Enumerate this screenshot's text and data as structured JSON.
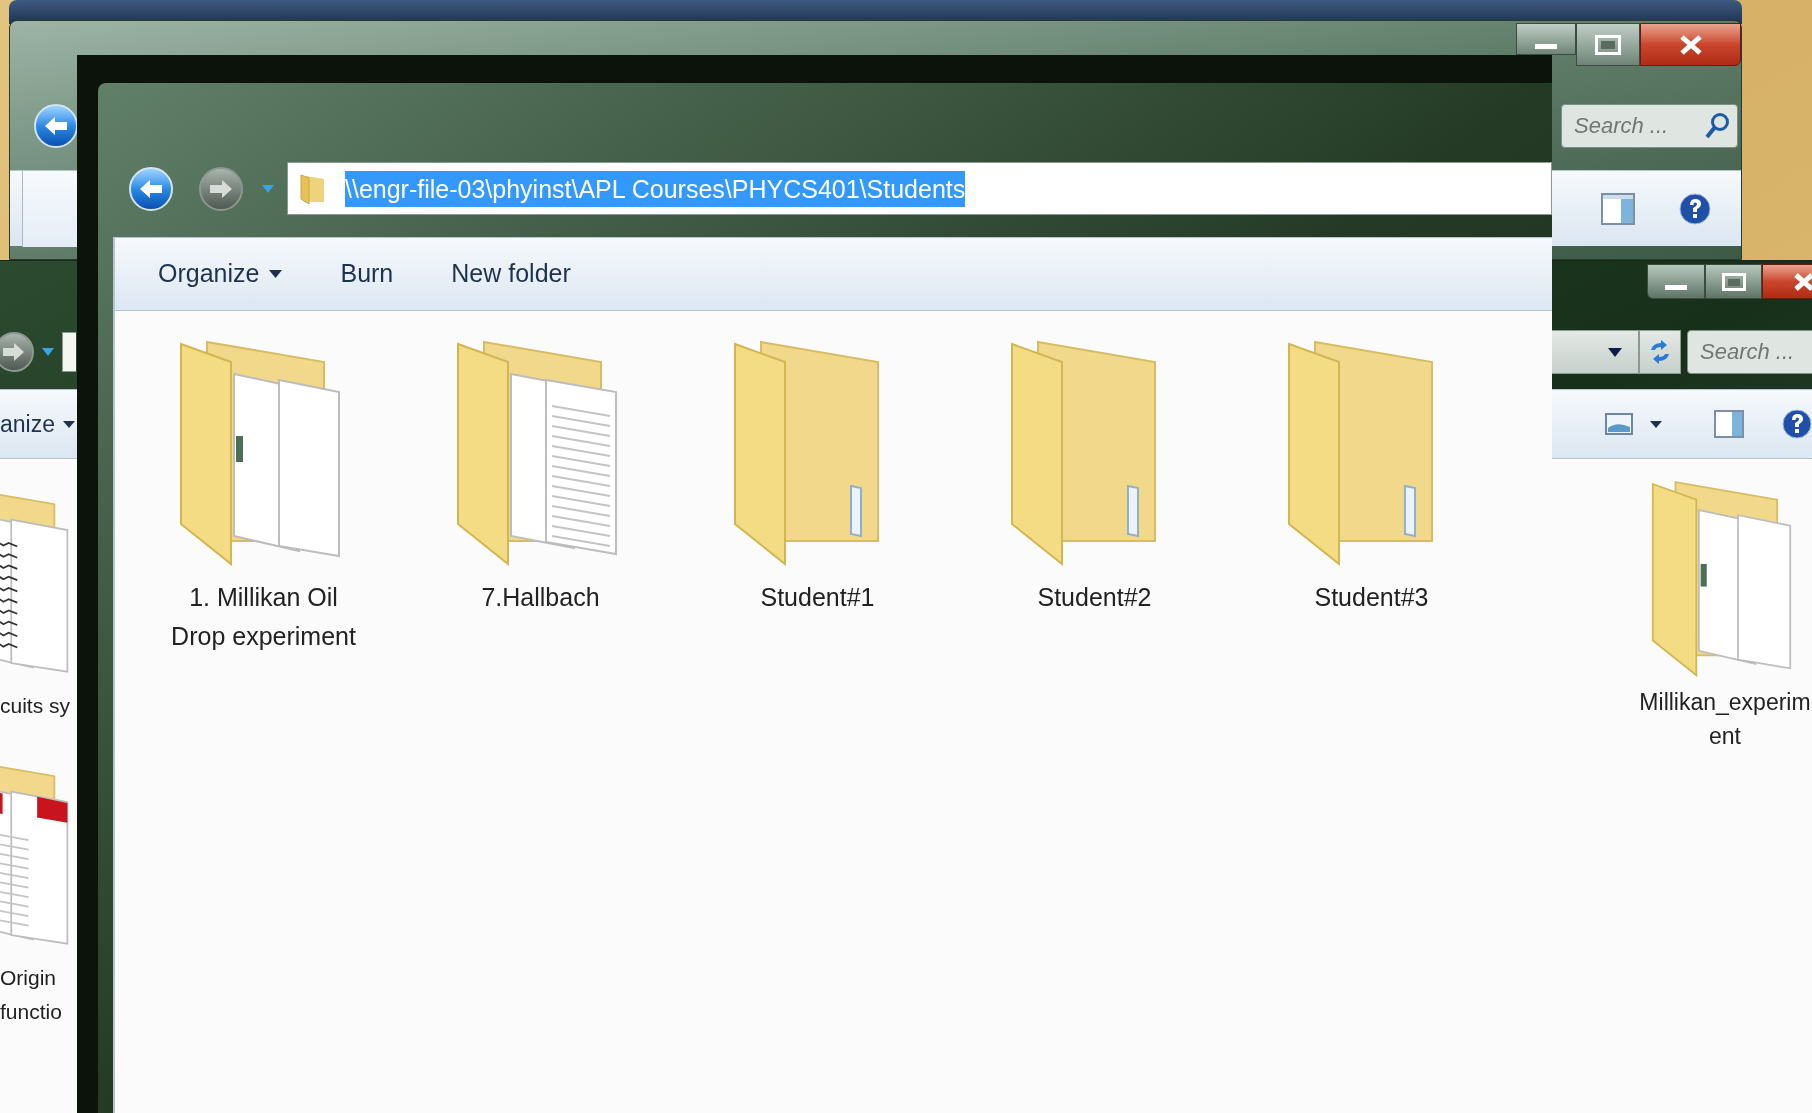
{
  "back_window_top": {
    "search": {
      "placeholder": "Search ..."
    }
  },
  "back_window_middle": {
    "toolbar": {
      "label": "anize"
    },
    "search": {
      "placeholder": "Search ..."
    },
    "left_items": [
      {
        "name": "cuits sy",
        "kind": "papers"
      },
      {
        "name": "Origin\nfunctio",
        "kind": "red-docs"
      }
    ],
    "right_items": [
      {
        "name": "Millikan_experim\nent",
        "kind": "docs"
      }
    ]
  },
  "front_window": {
    "address": {
      "path": "\\\\engr-file-03\\phyinst\\APL Courses\\PHYCS401\\Students",
      "selected": true
    },
    "toolbar": [
      {
        "label": "Organize",
        "kind": "menu"
      },
      {
        "label": "Burn",
        "kind": "button"
      },
      {
        "label": "New folder",
        "kind": "button"
      }
    ],
    "items": [
      {
        "name": "1. Millikan Oil\nDrop experiment",
        "kind": "docs"
      },
      {
        "name": "7.Hallbach",
        "kind": "files"
      },
      {
        "name": "Student#1",
        "kind": "empty"
      },
      {
        "name": "Student#2",
        "kind": "empty"
      },
      {
        "name": "Student#3",
        "kind": "empty"
      }
    ]
  }
}
